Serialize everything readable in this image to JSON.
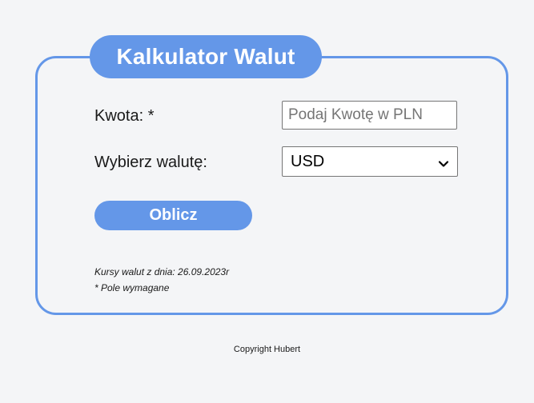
{
  "app": {
    "title": "Kalkulator Walut"
  },
  "form": {
    "amount_label": "Kwota: *",
    "amount_value": "",
    "amount_placeholder": "Podaj Kwotę w PLN",
    "currency_label": "Wybierz walutę:",
    "currency_selected": "USD",
    "submit_label": "Oblicz"
  },
  "notes": {
    "rates_date": "Kursy walut z dnia: 26.09.2023r",
    "required": "* Pole wymagane"
  },
  "footer": {
    "copyright": "Copyright Hubert"
  },
  "colors": {
    "accent": "#6497e8",
    "background": "#f4f5f7"
  },
  "icons": {
    "select_arrow": "chevron-down-icon"
  }
}
